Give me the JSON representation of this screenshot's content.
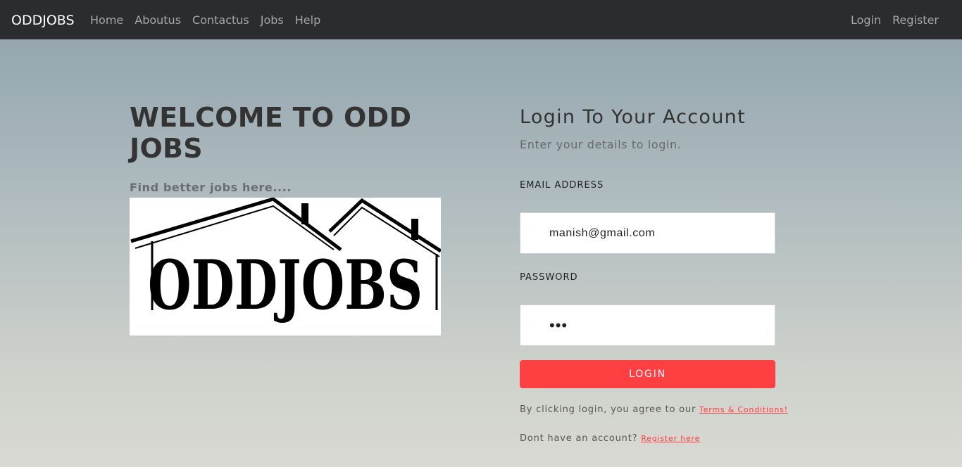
{
  "navbar": {
    "brand": "ODDJOBS",
    "left_links": [
      "Home",
      "Aboutus",
      "Contactus",
      "Jobs",
      "Help"
    ],
    "right_links": [
      "Login",
      "Register"
    ]
  },
  "hero": {
    "title": "WELCOME TO ODD JOBS",
    "tagline": "Find better jobs here....",
    "logo_text": "ODDJOBS"
  },
  "login": {
    "title": "Login To Your Account",
    "subtitle": "Enter your details to login.",
    "email_label": "EMAIL ADDRESS",
    "email_value": "manish@gmail.com",
    "password_label": "PASSWORD",
    "password_value": "•••",
    "button_label": "LOGIN",
    "terms_text": "By clicking login, you agree to our",
    "terms_link": "Terms & Conditions!",
    "register_text": "Dont have an account?",
    "register_link": "Register here"
  },
  "colors": {
    "navbar_bg": "#2b2c2f",
    "accent": "#ff4043"
  }
}
